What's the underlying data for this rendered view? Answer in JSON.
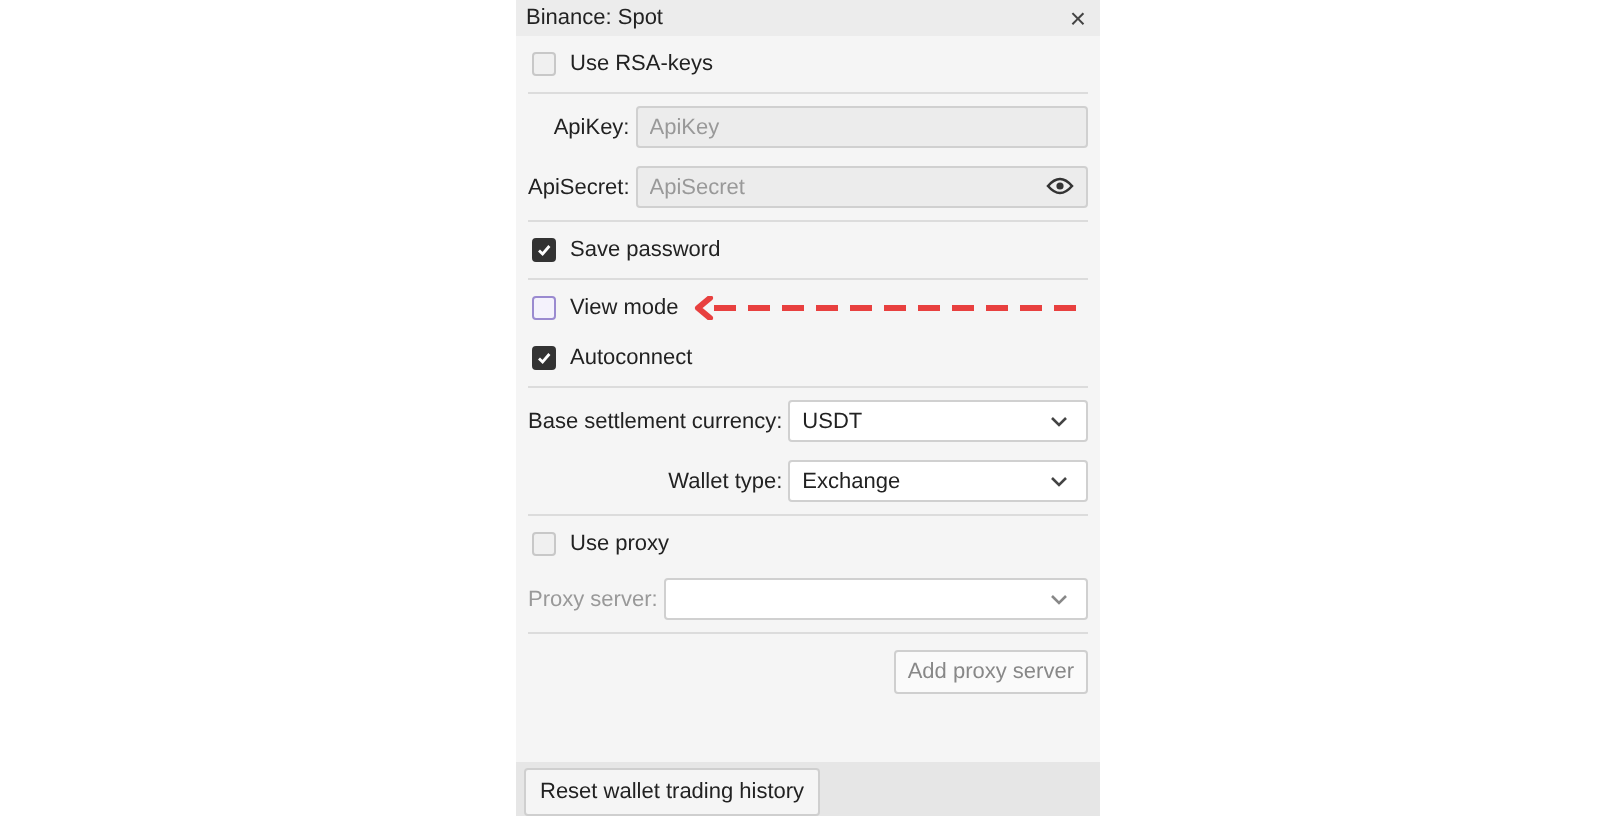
{
  "window": {
    "title": "Binance: Spot",
    "close": "×"
  },
  "sections": [
    {
      "items": [
        {
          "kind": "checkbox",
          "label": "Use RSA-keys",
          "checked": false,
          "annotated": false
        }
      ]
    },
    {
      "items": [
        {
          "kind": "field",
          "label": "ApiKey:",
          "placeholder": "ApiKey",
          "reveal": false
        },
        {
          "kind": "field",
          "label": "ApiSecret:",
          "placeholder": "ApiSecret",
          "reveal": true
        }
      ]
    },
    {
      "items": [
        {
          "kind": "checkbox",
          "label": "Save password",
          "checked": true,
          "annotated": false
        }
      ]
    },
    {
      "items": [
        {
          "kind": "checkbox",
          "label": "View mode",
          "checked": false,
          "annotated": true
        },
        {
          "kind": "checkbox",
          "label": "Autoconnect",
          "checked": true,
          "annotated": false
        }
      ]
    },
    {
      "items": [
        {
          "kind": "select",
          "label": "Base settlement currency:",
          "value": "USDT",
          "disabled": false
        },
        {
          "kind": "select",
          "label": "Wallet type:",
          "value": "Exchange",
          "disabled": false
        }
      ]
    },
    {
      "items": [
        {
          "kind": "checkbox",
          "label": "Use proxy",
          "checked": false,
          "annotated": false
        },
        {
          "kind": "select",
          "label": "Proxy server:",
          "value": "",
          "disabled": true
        }
      ]
    },
    {
      "items": [
        {
          "kind": "button",
          "label": "Add proxy server",
          "disabled": true
        }
      ]
    }
  ],
  "footer": {
    "button": "Reset wallet trading history"
  }
}
